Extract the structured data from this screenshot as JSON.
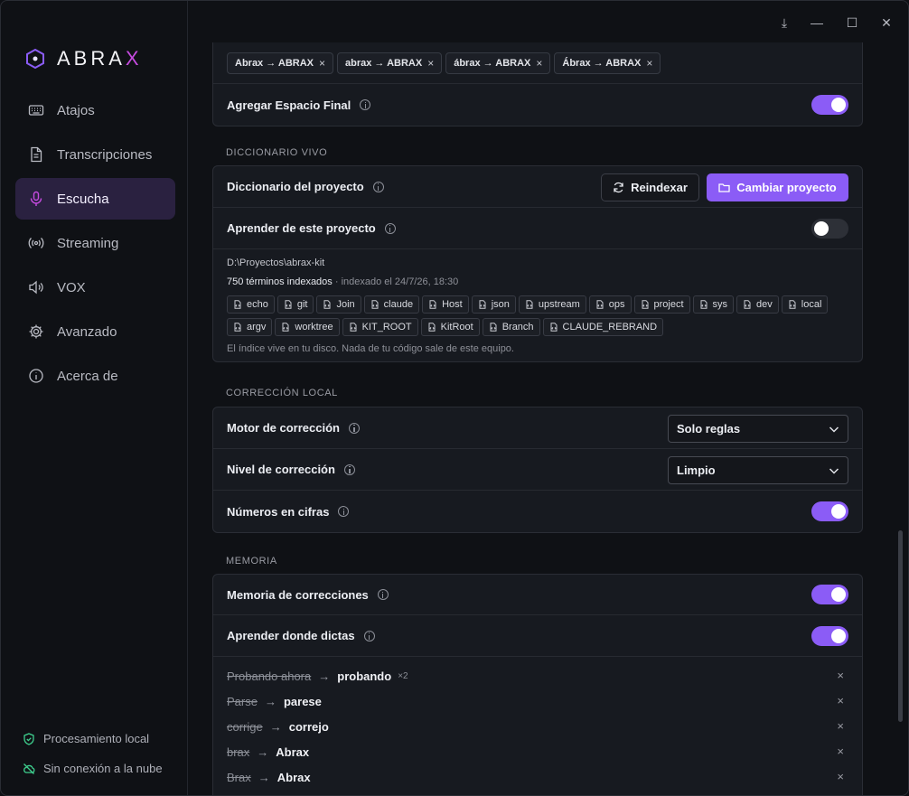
{
  "app": {
    "logo_main": "ABRA",
    "logo_accent": "X",
    "accent": "#8b5cf6"
  },
  "window": {
    "download": "⤓",
    "minimize": "—",
    "maximize": "☐",
    "close": "✕"
  },
  "sidebar": {
    "items": [
      {
        "label": "Atajos",
        "icon": "keyboard-icon"
      },
      {
        "label": "Transcripciones",
        "icon": "document-icon"
      },
      {
        "label": "Escucha",
        "icon": "microphone-icon",
        "active": true
      },
      {
        "label": "Streaming",
        "icon": "broadcast-icon"
      },
      {
        "label": "VOX",
        "icon": "speaker-icon"
      },
      {
        "label": "Avanzado",
        "icon": "gear-icon"
      },
      {
        "label": "Acerca de",
        "icon": "info-icon"
      }
    ],
    "footer": {
      "local": "Procesamiento local",
      "offline": "Sin conexión a la nube"
    }
  },
  "replacements": {
    "chips": [
      "Abrax → ABRAX",
      "abrax → ABRAX",
      "ábrax → ABRAX",
      "Ábrax → ABRAX"
    ],
    "remove": "×",
    "final_space_label": "Agregar Espacio Final",
    "final_space_on": true
  },
  "dictionary": {
    "section_title": "DICCIONARIO VIVO",
    "project_label": "Diccionario del proyecto",
    "reindex_button": "Reindexar",
    "change_button": "Cambiar proyecto",
    "learn_label": "Aprender de este proyecto",
    "learn_on": false,
    "path": "D:\\Proyectos\\abrax-kit",
    "indexed_count": "750 términos indexados",
    "indexed_date": " · indexado el 24/7/26, 18:30",
    "terms": [
      "echo",
      "git",
      "Join",
      "claude",
      "Host",
      "json",
      "upstream",
      "ops",
      "project",
      "sys",
      "dev",
      "local",
      "argv",
      "worktree",
      "KIT_ROOT",
      "KitRoot",
      "Branch",
      "CLAUDE_REBRAND"
    ],
    "note": "El índice vive en tu disco. Nada de tu código sale de este equipo."
  },
  "correction": {
    "section_title": "CORRECCIÓN LOCAL",
    "engine_label": "Motor de corrección",
    "engine_value": "Solo reglas",
    "level_label": "Nivel de corrección",
    "level_value": "Limpio",
    "numbers_label": "Números en cifras",
    "numbers_on": true
  },
  "memory": {
    "section_title": "MEMORIA",
    "memory_label": "Memoria de correcciones",
    "memory_on": true,
    "learn_label": "Aprender donde dictas",
    "learn_on": true,
    "arrow": "→",
    "entries": [
      {
        "from": "Probando ahora",
        "to": "probando",
        "count": "×2"
      },
      {
        "from": "Parse",
        "to": "parese",
        "count": ""
      },
      {
        "from": "corrige",
        "to": "correjo",
        "count": ""
      },
      {
        "from": "brax",
        "to": "Abrax",
        "count": ""
      },
      {
        "from": "Brax",
        "to": "Abrax",
        "count": ""
      }
    ],
    "remove": "×"
  }
}
